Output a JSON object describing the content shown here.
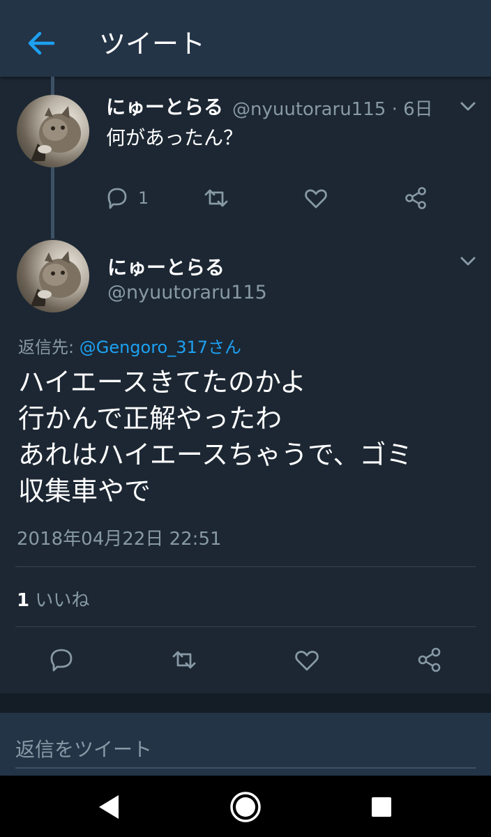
{
  "header": {
    "title": "ツイート",
    "back_icon": "back-arrow-icon",
    "accent_color": "#1da1f2"
  },
  "parent_tweet": {
    "display_name": "にゅーとらる",
    "handle_time": "@nyuutoraru115 · 6日",
    "text": "何があったん？",
    "reply_count": "1",
    "icons": [
      "reply-icon",
      "retweet-icon",
      "like-icon",
      "share-icon",
      "chevron-down-icon"
    ]
  },
  "tweet": {
    "display_name": "にゅーとらる",
    "handle": "@nyuutoraru115",
    "replying_prefix": "返信先: ",
    "replying_mention": "@Gengoro_317さん",
    "lines": [
      "ハイエースきてたのかよ",
      "行かんで正解やったわ",
      "あれはハイエースちゃうで、ゴミ",
      "収集車やで"
    ],
    "timestamp": "2018年04月22日 22:51",
    "like_count": "1",
    "like_label": " いいね"
  },
  "reply_box": {
    "placeholder": "返信をツイート"
  },
  "system_nav": {
    "icons": [
      "nav-back-icon",
      "nav-home-icon",
      "nav-recents-icon"
    ]
  }
}
